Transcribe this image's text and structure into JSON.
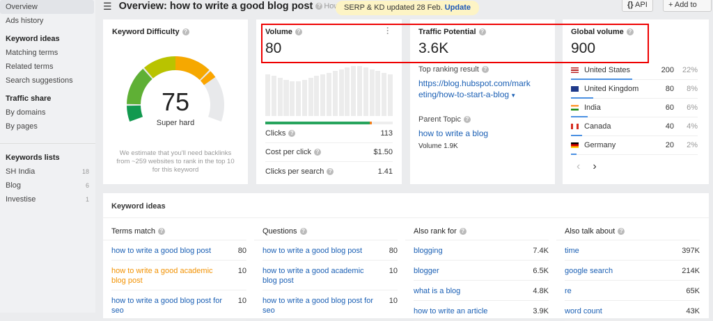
{
  "sidebar": {
    "items_top": [
      {
        "label": "Overview",
        "active": true
      },
      {
        "label": "Ads history"
      }
    ],
    "groups": [
      {
        "title": "Keyword ideas",
        "items": [
          {
            "label": "Matching terms"
          },
          {
            "label": "Related terms"
          },
          {
            "label": "Search suggestions"
          }
        ]
      },
      {
        "title": "Traffic share",
        "items": [
          {
            "label": "By domains"
          },
          {
            "label": "By pages"
          }
        ]
      }
    ],
    "lists_title": "Keywords lists",
    "lists": [
      {
        "label": "SH India",
        "count": "18"
      },
      {
        "label": "Blog",
        "count": "6"
      },
      {
        "label": "Investise",
        "count": "1"
      }
    ]
  },
  "header": {
    "title": "Overview: how to write a good blog post",
    "help_truncated": "How",
    "toast_text": "SERP & KD updated 28 Feb.",
    "toast_link": "Update",
    "api_label": "API",
    "add_label": "Add to"
  },
  "kd": {
    "title": "Keyword Difficulty",
    "value": "75",
    "score": 75,
    "label": "Super hard",
    "note": "We estimate that you'll need backlinks from ~259 websites to rank in the top 10 for this keyword",
    "colors": {
      "green": "#1e9e4a",
      "yellow": "#c8c400",
      "orange": "#f6a800",
      "track": "#e8e9eb"
    }
  },
  "volume": {
    "title": "Volume",
    "value": "80",
    "history_relative": [
      175,
      168,
      160,
      153,
      147,
      147,
      153,
      160,
      168,
      175,
      182,
      189,
      196,
      203,
      210,
      210,
      203,
      196,
      189,
      182,
      175
    ],
    "clicks_bar": {
      "organic_pct": 82,
      "paid_pct": 1.5
    },
    "metrics": [
      {
        "label": "Clicks",
        "value": "113"
      },
      {
        "label": "Cost per click",
        "value": "$1.50"
      },
      {
        "label": "Clicks per search",
        "value": "1.41"
      }
    ]
  },
  "traffic": {
    "title": "Traffic Potential",
    "value": "3.6K",
    "top_label": "Top ranking result",
    "top_url": "https://blog.hubspot.com/marketing/how-to-start-a-blog",
    "parent_label": "Parent Topic",
    "parent_link": "how to write a blog",
    "parent_volume": "Volume 1.9K"
  },
  "global": {
    "title": "Global volume",
    "value": "900",
    "countries": [
      {
        "name": "United States",
        "value": "200",
        "pct": "22%",
        "share": 22,
        "flag": "us"
      },
      {
        "name": "United Kingdom",
        "value": "80",
        "pct": "8%",
        "share": 8,
        "flag": "gb"
      },
      {
        "name": "India",
        "value": "60",
        "pct": "6%",
        "share": 6,
        "flag": "in"
      },
      {
        "name": "Canada",
        "value": "40",
        "pct": "4%",
        "share": 4,
        "flag": "ca"
      },
      {
        "name": "Germany",
        "value": "20",
        "pct": "2%",
        "share": 2,
        "flag": "de"
      }
    ],
    "prev": "‹",
    "next": "›"
  },
  "ideas": {
    "title": "Keyword ideas",
    "columns": [
      {
        "title": "Terms match",
        "rows": [
          {
            "k": "how to write a good blog post",
            "v": "80"
          },
          {
            "k": "how to write a good academic blog post",
            "v": "10",
            "orange": true
          },
          {
            "k": "how to write a good blog post for seo",
            "v": "10"
          }
        ]
      },
      {
        "title": "Questions",
        "rows": [
          {
            "k": "how to write a good blog post",
            "v": "80"
          },
          {
            "k": "how to write a good academic blog post",
            "v": "10"
          },
          {
            "k": "how to write a good blog post for seo",
            "v": "10"
          }
        ]
      },
      {
        "title": "Also rank for",
        "rows": [
          {
            "k": "blogging",
            "v": "7.4K"
          },
          {
            "k": "blogger",
            "v": "6.5K"
          },
          {
            "k": "what is a blog",
            "v": "4.8K"
          },
          {
            "k": "how to write an article",
            "v": "3.9K"
          }
        ]
      },
      {
        "title": "Also talk about",
        "rows": [
          {
            "k": "time",
            "v": "397K"
          },
          {
            "k": "google search",
            "v": "214K"
          },
          {
            "k": "re",
            "v": "65K"
          },
          {
            "k": "word count",
            "v": "43K"
          }
        ]
      }
    ]
  }
}
